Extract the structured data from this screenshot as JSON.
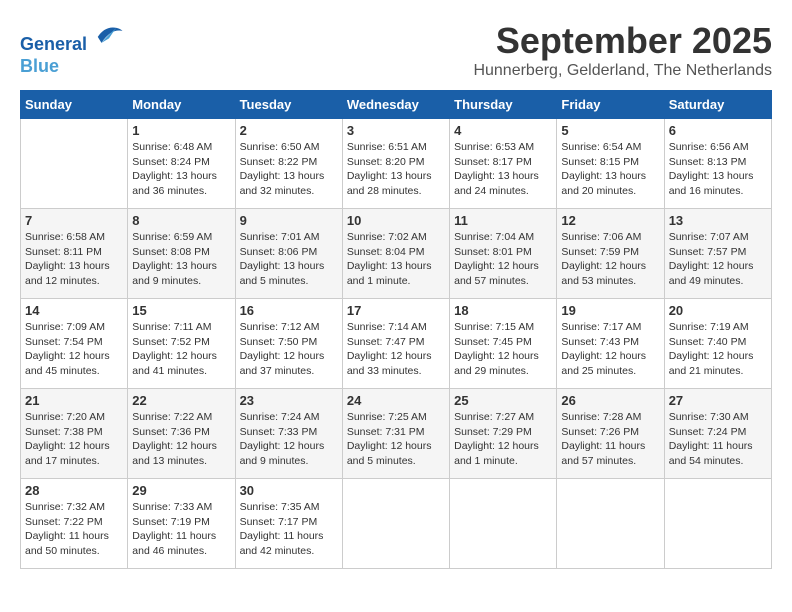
{
  "header": {
    "logo_line1": "General",
    "logo_line2": "Blue",
    "month": "September 2025",
    "location": "Hunnerberg, Gelderland, The Netherlands"
  },
  "weekdays": [
    "Sunday",
    "Monday",
    "Tuesday",
    "Wednesday",
    "Thursday",
    "Friday",
    "Saturday"
  ],
  "weeks": [
    [
      {
        "day": "",
        "info": ""
      },
      {
        "day": "1",
        "info": "Sunrise: 6:48 AM\nSunset: 8:24 PM\nDaylight: 13 hours\nand 36 minutes."
      },
      {
        "day": "2",
        "info": "Sunrise: 6:50 AM\nSunset: 8:22 PM\nDaylight: 13 hours\nand 32 minutes."
      },
      {
        "day": "3",
        "info": "Sunrise: 6:51 AM\nSunset: 8:20 PM\nDaylight: 13 hours\nand 28 minutes."
      },
      {
        "day": "4",
        "info": "Sunrise: 6:53 AM\nSunset: 8:17 PM\nDaylight: 13 hours\nand 24 minutes."
      },
      {
        "day": "5",
        "info": "Sunrise: 6:54 AM\nSunset: 8:15 PM\nDaylight: 13 hours\nand 20 minutes."
      },
      {
        "day": "6",
        "info": "Sunrise: 6:56 AM\nSunset: 8:13 PM\nDaylight: 13 hours\nand 16 minutes."
      }
    ],
    [
      {
        "day": "7",
        "info": "Sunrise: 6:58 AM\nSunset: 8:11 PM\nDaylight: 13 hours\nand 12 minutes."
      },
      {
        "day": "8",
        "info": "Sunrise: 6:59 AM\nSunset: 8:08 PM\nDaylight: 13 hours\nand 9 minutes."
      },
      {
        "day": "9",
        "info": "Sunrise: 7:01 AM\nSunset: 8:06 PM\nDaylight: 13 hours\nand 5 minutes."
      },
      {
        "day": "10",
        "info": "Sunrise: 7:02 AM\nSunset: 8:04 PM\nDaylight: 13 hours\nand 1 minute."
      },
      {
        "day": "11",
        "info": "Sunrise: 7:04 AM\nSunset: 8:01 PM\nDaylight: 12 hours\nand 57 minutes."
      },
      {
        "day": "12",
        "info": "Sunrise: 7:06 AM\nSunset: 7:59 PM\nDaylight: 12 hours\nand 53 minutes."
      },
      {
        "day": "13",
        "info": "Sunrise: 7:07 AM\nSunset: 7:57 PM\nDaylight: 12 hours\nand 49 minutes."
      }
    ],
    [
      {
        "day": "14",
        "info": "Sunrise: 7:09 AM\nSunset: 7:54 PM\nDaylight: 12 hours\nand 45 minutes."
      },
      {
        "day": "15",
        "info": "Sunrise: 7:11 AM\nSunset: 7:52 PM\nDaylight: 12 hours\nand 41 minutes."
      },
      {
        "day": "16",
        "info": "Sunrise: 7:12 AM\nSunset: 7:50 PM\nDaylight: 12 hours\nand 37 minutes."
      },
      {
        "day": "17",
        "info": "Sunrise: 7:14 AM\nSunset: 7:47 PM\nDaylight: 12 hours\nand 33 minutes."
      },
      {
        "day": "18",
        "info": "Sunrise: 7:15 AM\nSunset: 7:45 PM\nDaylight: 12 hours\nand 29 minutes."
      },
      {
        "day": "19",
        "info": "Sunrise: 7:17 AM\nSunset: 7:43 PM\nDaylight: 12 hours\nand 25 minutes."
      },
      {
        "day": "20",
        "info": "Sunrise: 7:19 AM\nSunset: 7:40 PM\nDaylight: 12 hours\nand 21 minutes."
      }
    ],
    [
      {
        "day": "21",
        "info": "Sunrise: 7:20 AM\nSunset: 7:38 PM\nDaylight: 12 hours\nand 17 minutes."
      },
      {
        "day": "22",
        "info": "Sunrise: 7:22 AM\nSunset: 7:36 PM\nDaylight: 12 hours\nand 13 minutes."
      },
      {
        "day": "23",
        "info": "Sunrise: 7:24 AM\nSunset: 7:33 PM\nDaylight: 12 hours\nand 9 minutes."
      },
      {
        "day": "24",
        "info": "Sunrise: 7:25 AM\nSunset: 7:31 PM\nDaylight: 12 hours\nand 5 minutes."
      },
      {
        "day": "25",
        "info": "Sunrise: 7:27 AM\nSunset: 7:29 PM\nDaylight: 12 hours\nand 1 minute."
      },
      {
        "day": "26",
        "info": "Sunrise: 7:28 AM\nSunset: 7:26 PM\nDaylight: 11 hours\nand 57 minutes."
      },
      {
        "day": "27",
        "info": "Sunrise: 7:30 AM\nSunset: 7:24 PM\nDaylight: 11 hours\nand 54 minutes."
      }
    ],
    [
      {
        "day": "28",
        "info": "Sunrise: 7:32 AM\nSunset: 7:22 PM\nDaylight: 11 hours\nand 50 minutes."
      },
      {
        "day": "29",
        "info": "Sunrise: 7:33 AM\nSunset: 7:19 PM\nDaylight: 11 hours\nand 46 minutes."
      },
      {
        "day": "30",
        "info": "Sunrise: 7:35 AM\nSunset: 7:17 PM\nDaylight: 11 hours\nand 42 minutes."
      },
      {
        "day": "",
        "info": ""
      },
      {
        "day": "",
        "info": ""
      },
      {
        "day": "",
        "info": ""
      },
      {
        "day": "",
        "info": ""
      }
    ]
  ]
}
